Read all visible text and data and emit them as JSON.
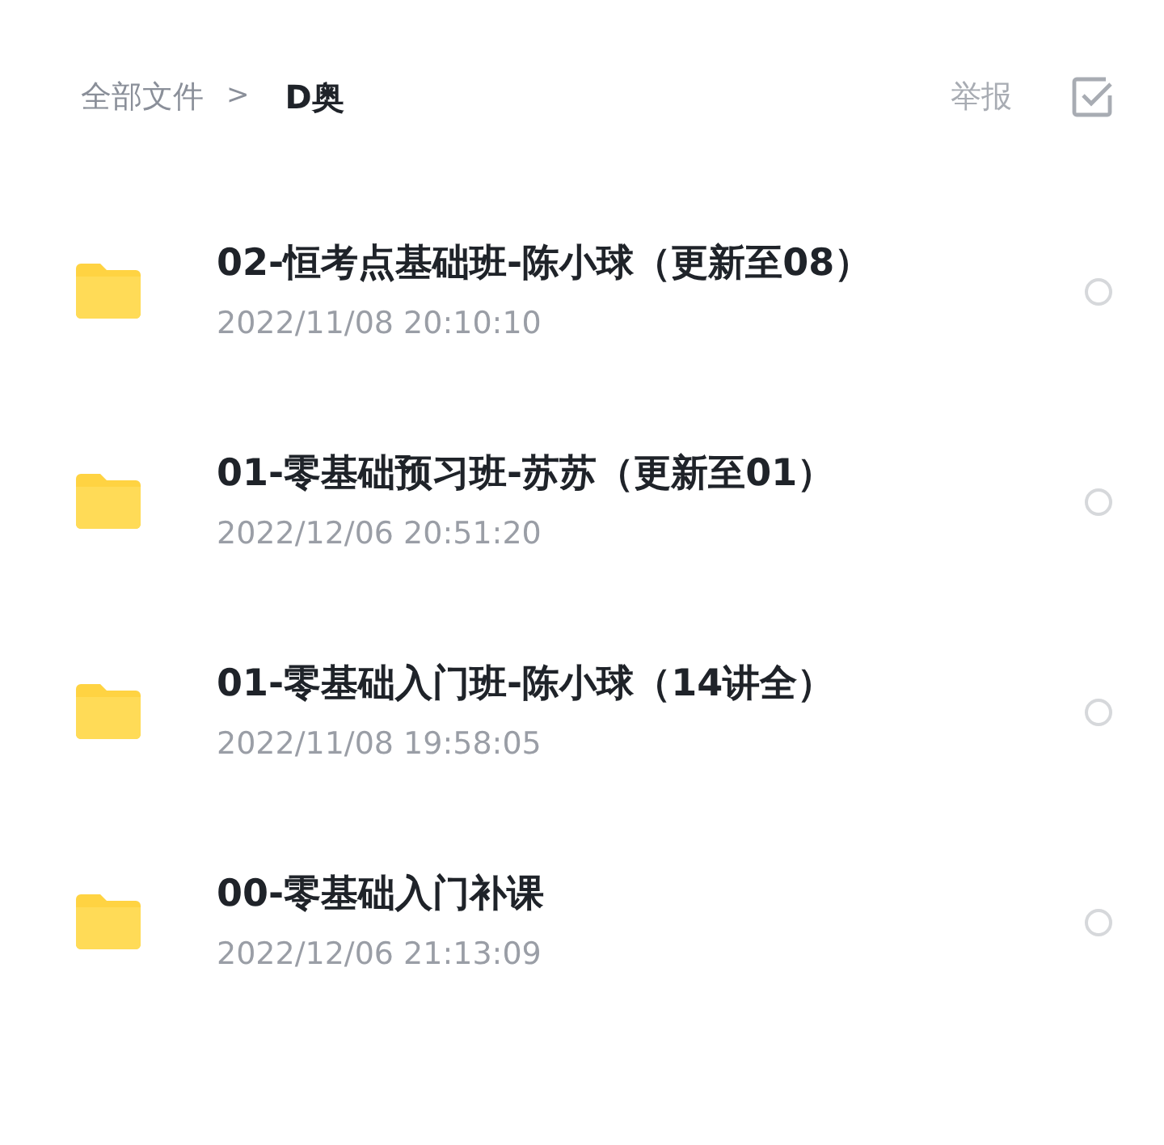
{
  "breadcrumb": {
    "root": "全部文件",
    "separator": ">",
    "current": "D奥"
  },
  "header_actions": {
    "report": "举报"
  },
  "files": [
    {
      "name": "02-恒考点基础班-陈小球（更新至08）",
      "date": "2022/11/08 20:10:10",
      "selected": false
    },
    {
      "name": "01-零基础预习班-苏苏（更新至01）",
      "date": "2022/12/06 20:51:20",
      "selected": false
    },
    {
      "name": "01-零基础入门班-陈小球（14讲全）",
      "date": "2022/11/08 19:58:05",
      "selected": false
    },
    {
      "name": "00-零基础入门补课",
      "date": "2022/12/06 21:13:09",
      "selected": false
    }
  ]
}
